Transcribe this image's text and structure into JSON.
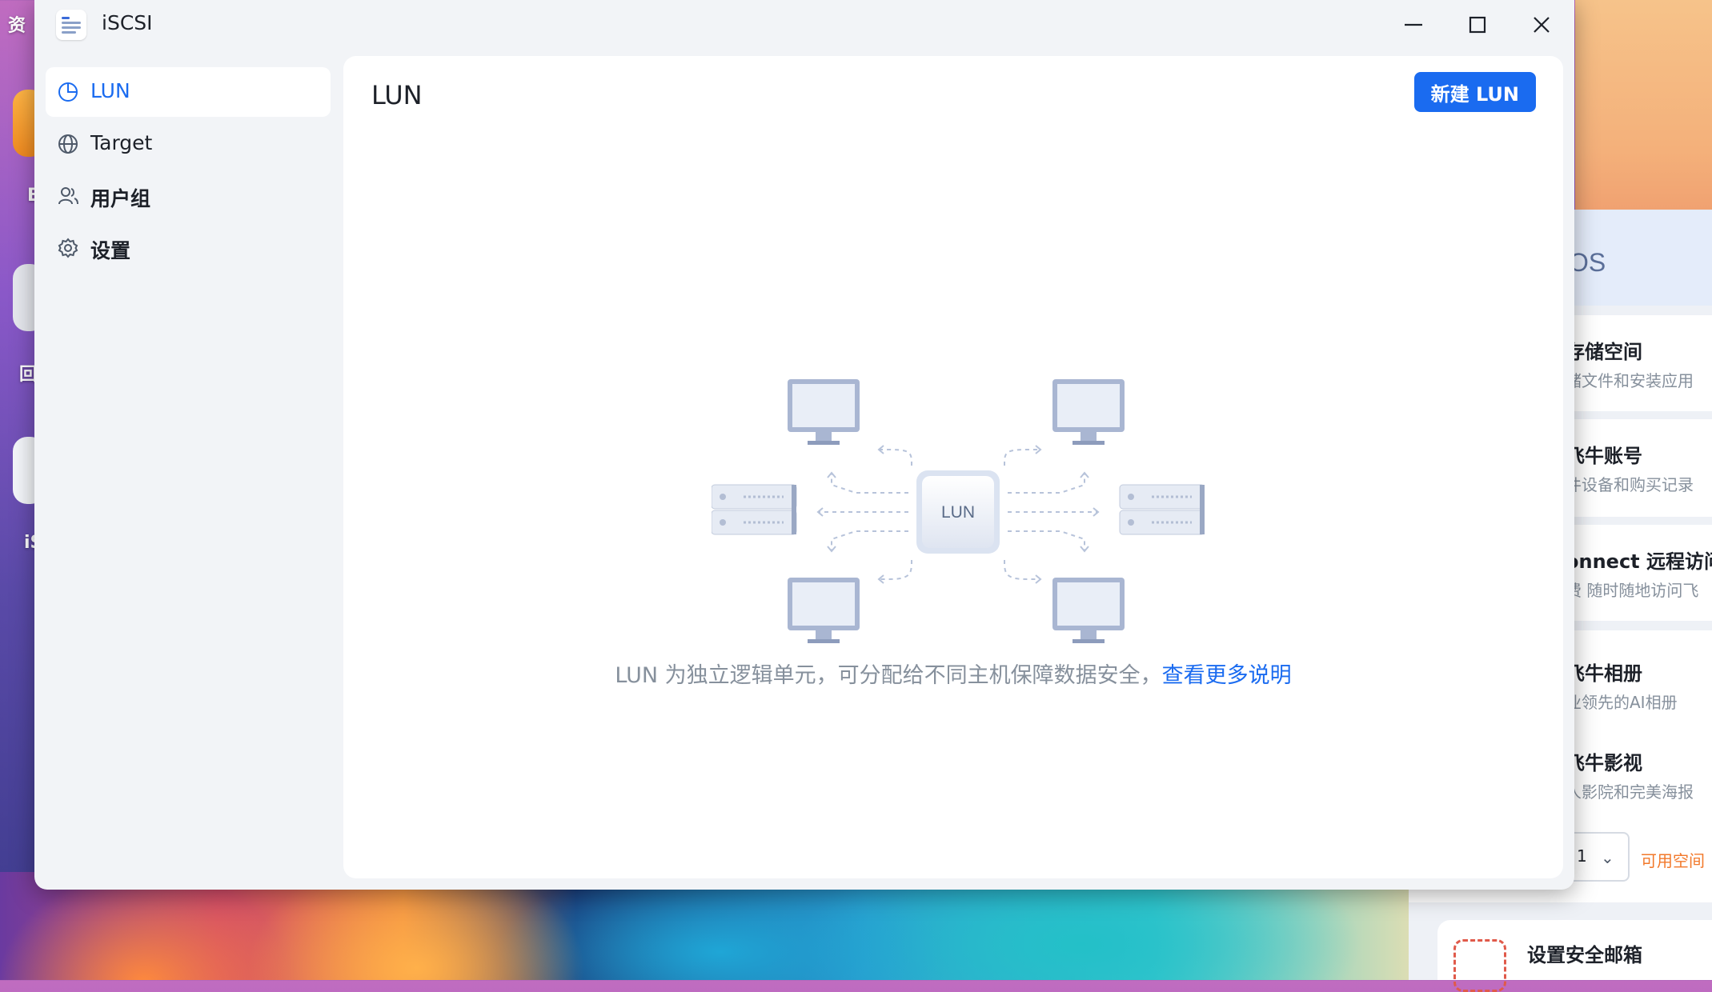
{
  "window": {
    "title": "iSCSI",
    "controls": [
      "minimize-icon",
      "maximize-icon",
      "close-icon"
    ]
  },
  "sidebar": {
    "items": [
      {
        "label": "LUN",
        "icon": "pie-chart-icon",
        "active": true
      },
      {
        "label": "Target",
        "icon": "globe-icon",
        "active": false
      },
      {
        "label": "用户组",
        "icon": "user-group-icon",
        "active": false
      },
      {
        "label": "设置",
        "icon": "gear-icon",
        "active": false
      }
    ]
  },
  "main": {
    "title": "LUN",
    "new_button": "新建 LUN",
    "illustration_label": "LUN",
    "description": "LUN 为独立逻辑单元，可分配给不同主机保障数据安全，",
    "link": "查看更多说明"
  },
  "desktop": {
    "labels": [
      "资",
      "B",
      "回",
      "iS"
    ]
  },
  "background_app": {
    "header": "OS",
    "cards": [
      {
        "title": "存储空间",
        "subtitle": "储文件和安装应用"
      },
      {
        "title": "飞牛账号",
        "subtitle": "件设备和购买记录"
      },
      {
        "title": "onnect 远程访问",
        "subtitle": "费 随时随地访问飞"
      },
      {
        "title": "飞牛相册",
        "subtitle": "业领先的AI相册"
      },
      {
        "title": "飞牛影视",
        "subtitle": "人影院和完美海报"
      }
    ],
    "select_value": "1",
    "orange_text": "可用空间",
    "mail_title": "设置安全邮箱"
  },
  "colors": {
    "accent": "#1a6bf0",
    "text_primary": "#1d2129",
    "text_secondary": "#86909c",
    "window_bg": "#f2f4f7"
  }
}
